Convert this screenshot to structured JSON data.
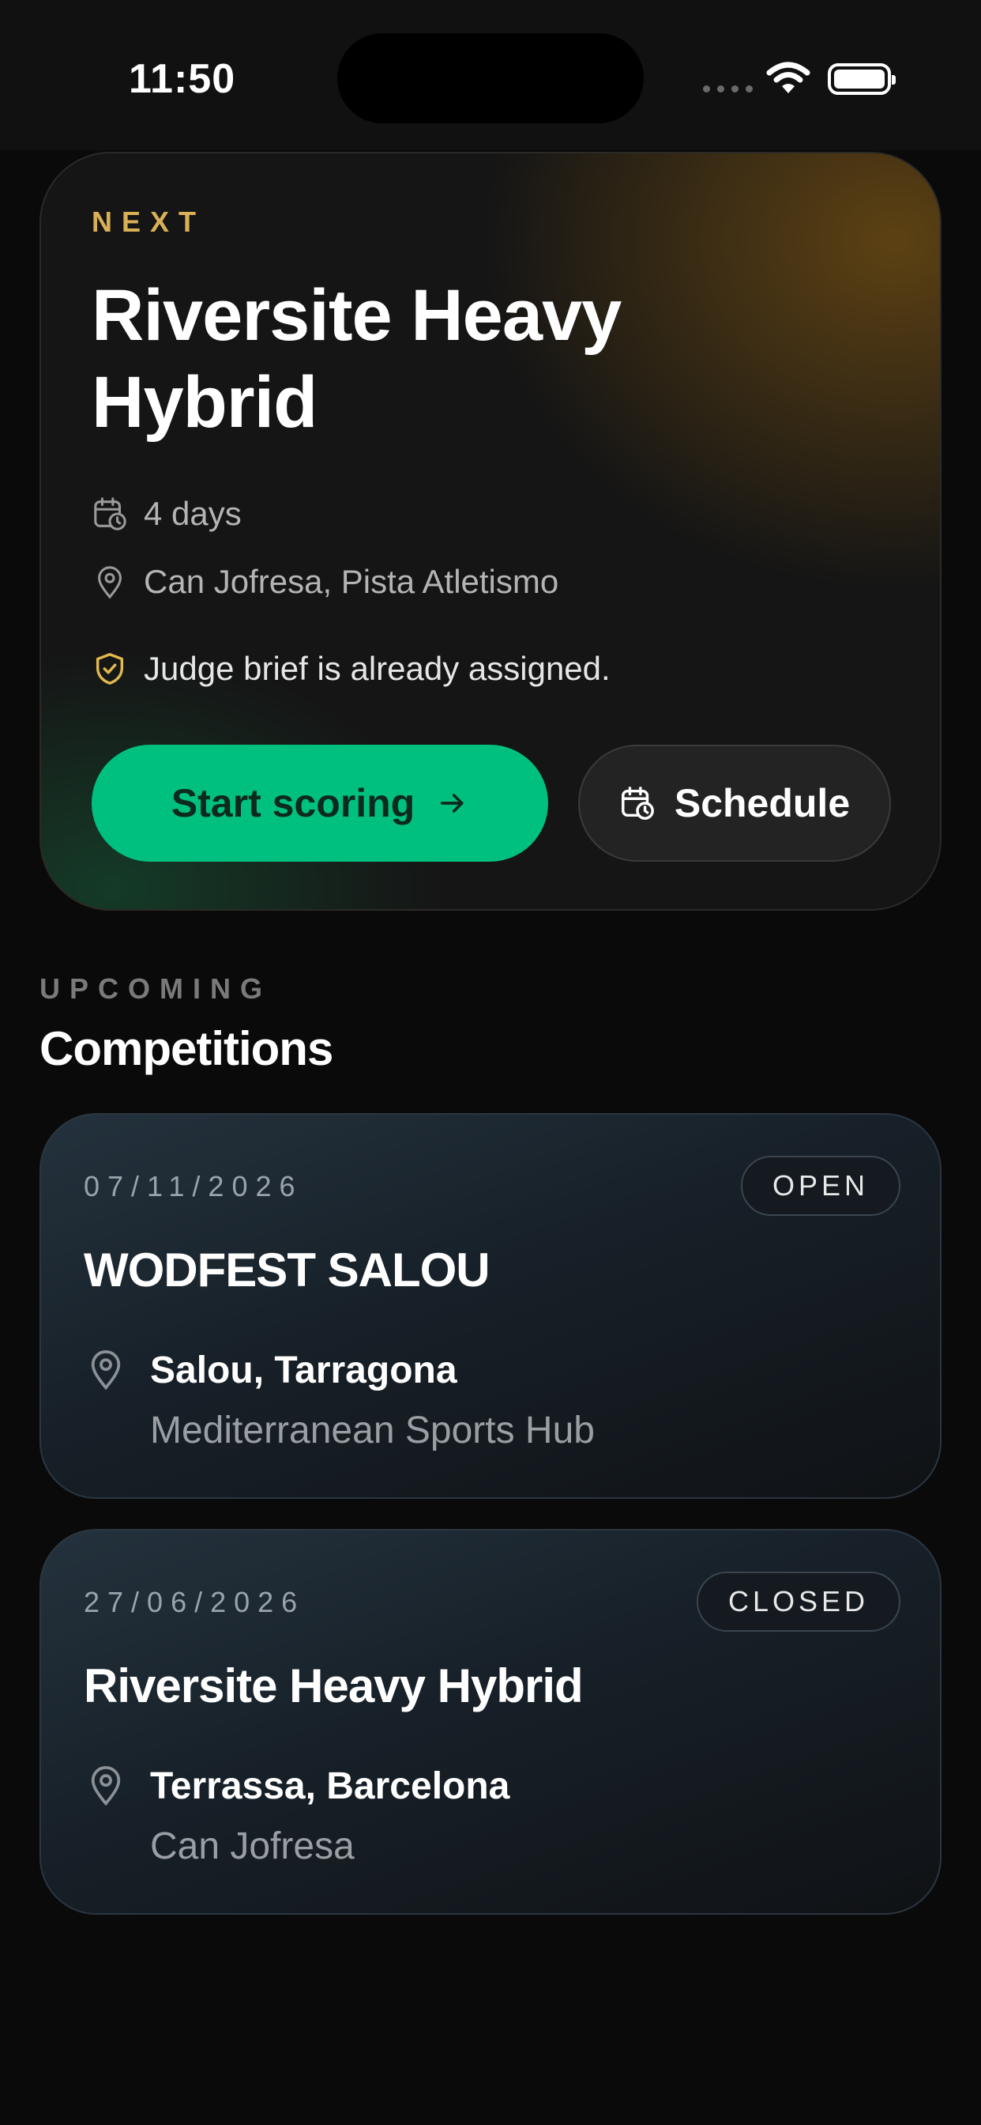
{
  "status_bar": {
    "time": "11:50"
  },
  "next_event": {
    "kicker": "NEXT",
    "title": "Riversite Heavy Hybrid",
    "days": "4 days",
    "location": "Can Jofresa, Pista Atletismo",
    "judge_note": "Judge brief is already assigned.",
    "start_button": "Start scoring",
    "schedule_button": "Schedule"
  },
  "upcoming": {
    "kicker": "UPCOMING",
    "title": "Competitions",
    "items": [
      {
        "date": "07/11/2026",
        "status": "OPEN",
        "name": "WODFEST SALOU",
        "city": "Salou, Tarragona",
        "venue": "Mediterranean Sports Hub"
      },
      {
        "date": "27/06/2026",
        "status": "CLOSED",
        "name": "Riversite Heavy Hybrid",
        "city": "Terrassa, Barcelona",
        "venue": "Can Jofresa"
      }
    ]
  },
  "colors": {
    "accent_green": "#00c080",
    "accent_gold": "#d9b056",
    "background": "#0a0a0b"
  }
}
